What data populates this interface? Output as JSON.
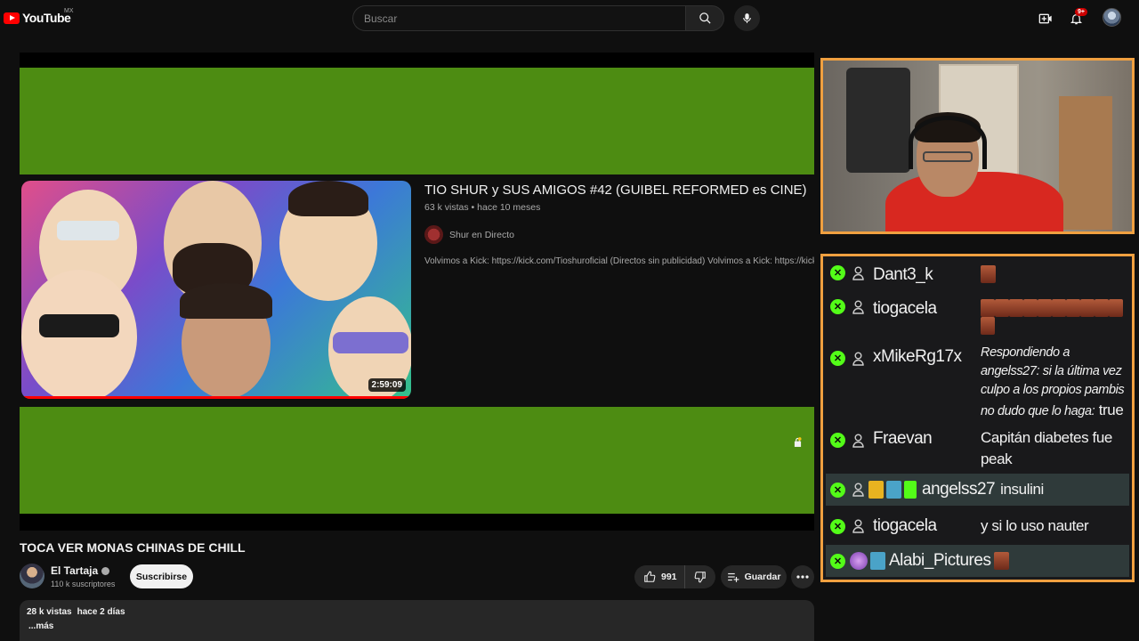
{
  "header": {
    "logo_text": "YouTube",
    "country_code": "MX",
    "search_placeholder": "Buscar",
    "notification_count": "9+"
  },
  "player": {
    "embedded_video": {
      "title": "TIO SHUR y SUS AMIGOS #42 (GUIBEL REFORMED es CINE)",
      "views": "63 k vistas",
      "separator": "•",
      "age": "hace 10 meses",
      "channel": "Shur en Directo",
      "description": "Volvimos a Kick: https://kick.com/Tioshuroficial (Directos sin publicidad) Volvimos a Kick: https://kick.com/Tioshuroficial",
      "duration": "2:59:09"
    },
    "background_color": "#4d8c12"
  },
  "video": {
    "title": "TOCA VER MONAS CHINAS DE CHILL",
    "channel_name": "El Tartaja",
    "subscribers": "110 k suscriptores",
    "subscribe_label": "Suscribirse",
    "likes": "991",
    "save_label": "Guardar",
    "views": "28 k vistas",
    "age": "hace 2 días",
    "more_label": "...más"
  },
  "chat": {
    "accent_color": "#53fc18",
    "messages": [
      {
        "user": "Dant3_k",
        "text": ""
      },
      {
        "user": "tiogacela",
        "text": ""
      },
      {
        "user": "xMikeRg17x",
        "reply": "Respondiendo a angelss27: si la última vez culpo a los propios pambis no dudo que lo haga:",
        "text": "true"
      },
      {
        "user": "Fraevan",
        "text": "Capitán diabetes fue peak"
      },
      {
        "user": "angelss27",
        "text": "insulini"
      },
      {
        "user": "tiogacela",
        "text": "y si lo uso nauter"
      },
      {
        "user": "Alabi_Pictures",
        "text": ""
      }
    ]
  }
}
